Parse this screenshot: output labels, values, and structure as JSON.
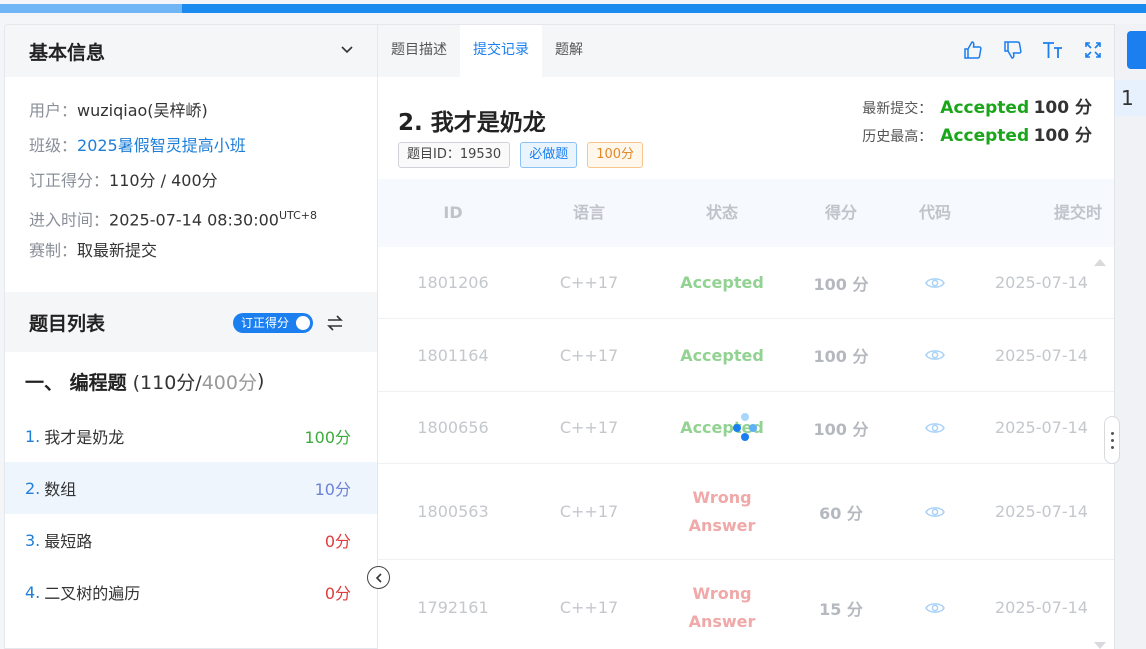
{
  "left": {
    "basic_info_title": "基本信息",
    "info": [
      {
        "k": "用户：",
        "v": "wuziqiao(吴梓峤)"
      },
      {
        "k": "班级：",
        "v": "2025暑假智灵提高小班"
      },
      {
        "k": "订正得分：",
        "v": "110分 / 400分"
      },
      {
        "k": "进入时间：",
        "v": "2025-07-14 08:30:00",
        "sup": "UTC+8"
      },
      {
        "k": "赛制：",
        "v": "取最新提交"
      }
    ],
    "list_title": "题目列表",
    "toggle_label": "订正得分",
    "category": {
      "lead": "一、 编程题",
      "score_open": "(110分/",
      "total": "400分",
      "score_close": ")"
    },
    "problems": [
      {
        "num": "1.",
        "name": "我才是奶龙",
        "score": "100分",
        "color": "#3bab3b"
      },
      {
        "num": "2.",
        "name": "数组",
        "score": "10分",
        "color": "#6b82d6"
      },
      {
        "num": "3.",
        "name": "最短路",
        "score": "0分",
        "color": "#e03a3a"
      },
      {
        "num": "4.",
        "name": "二叉树的遍历",
        "score": "0分",
        "color": "#e03a3a"
      }
    ]
  },
  "right": {
    "tabs": [
      "题目描述",
      "提交记录",
      "题解"
    ],
    "active_tab": "提交记录",
    "toolbar_icons": [
      "thumbs-up-icon",
      "thumbs-down-icon",
      "font-size-icon",
      "fullscreen-icon"
    ],
    "title": "2.  我才是奶龙",
    "tags": [
      "题目ID：19530",
      "必做题",
      "100分"
    ],
    "latest_label": "最新提交：",
    "latest_status": "Accepted",
    "latest_points": "100 分",
    "best_label": "历史最高：",
    "best_status": "Accepted",
    "best_points": "100 分",
    "columns": [
      "ID",
      "语言",
      "状态",
      "得分",
      "代码",
      "提交时"
    ],
    "rows": [
      {
        "id": "1801206",
        "lang": "C++17",
        "status": "Accepted",
        "wa": false,
        "points": "100 分",
        "time": "2025-07-14"
      },
      {
        "id": "1801164",
        "lang": "C++17",
        "status": "Accepted",
        "wa": false,
        "points": "100 分",
        "time": "2025-07-14"
      },
      {
        "id": "1800656",
        "lang": "C++17",
        "status": "Accepted",
        "wa": false,
        "points": "100 分",
        "time": "2025-07-14"
      },
      {
        "id": "1800563",
        "lang": "C++17",
        "status": "Wrong Answer",
        "status_l1": "Wrong",
        "status_l2": "Answer",
        "wa": true,
        "points": "60 分",
        "time": "2025-07-14"
      },
      {
        "id": "1792161",
        "lang": "C++17",
        "status": "Wrong Answer",
        "status_l1": "Wrong",
        "status_l2": "Answer",
        "wa": true,
        "points": "15 分",
        "time": "2025-07-14"
      }
    ]
  },
  "strip": {
    "line_number": "1"
  },
  "progress": 0.159
}
